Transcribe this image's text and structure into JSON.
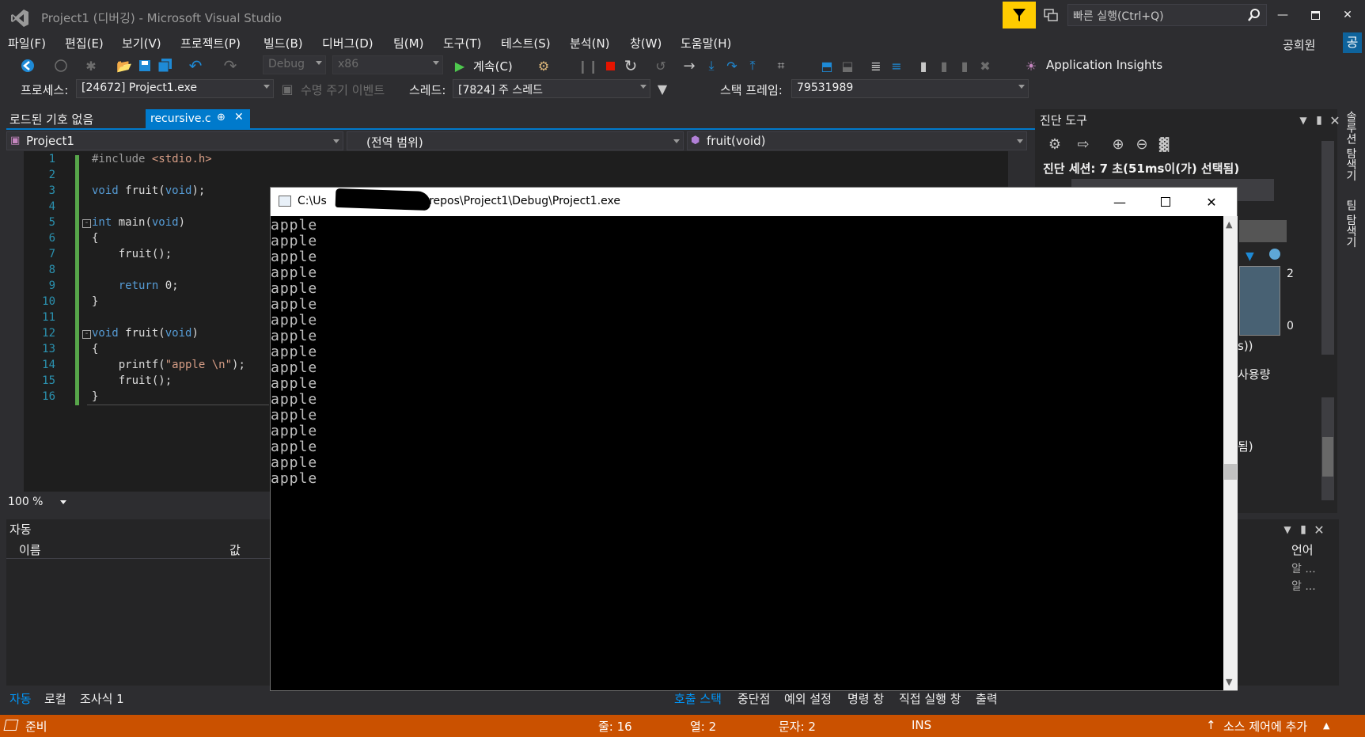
{
  "window": {
    "title": "Project1 (디버깅) - Microsoft Visual Studio",
    "quick_launch_placeholder": "빠른 실행(Ctrl+Q)",
    "user": "공희원",
    "user_badge": "공"
  },
  "menu": [
    "파일(F)",
    "편집(E)",
    "보기(V)",
    "프로젝트(P)",
    "빌드(B)",
    "디버그(D)",
    "팀(M)",
    "도구(T)",
    "테스트(S)",
    "분석(N)",
    "창(W)",
    "도움말(H)"
  ],
  "toolbar": {
    "config": "Debug",
    "platform": "x86",
    "continue_label": "계속(C)",
    "app_insights": "Application Insights"
  },
  "debug_location": {
    "process_label": "프로세스:",
    "process_value": "[24672] Project1.exe",
    "lifecycle_label": "수명 주기 이벤트",
    "thread_label": "스레드:",
    "thread_value": "[7824] 주 스레드",
    "stackframe_label": "스택 프레임:",
    "stackframe_value": "79531989"
  },
  "editor": {
    "no_symbols_tab": "로드된 기호 없음",
    "active_tab": "recursive.c",
    "nav_project": "Project1",
    "nav_scope": "(전역 범위)",
    "nav_function": "fruit(void)",
    "zoom": "100 %",
    "line_numbers": [
      "1",
      "2",
      "3",
      "4",
      "5",
      "6",
      "7",
      "8",
      "9",
      "10",
      "11",
      "12",
      "13",
      "14",
      "15",
      "16"
    ],
    "lines": [
      "#include <stdio.h>",
      "",
      "void fruit(void);",
      "",
      "int main(void)",
      "{",
      "    fruit();",
      "",
      "    return 0;",
      "}",
      "",
      "void fruit(void)",
      "{",
      "    printf(\"apple \\n\");",
      "    fruit();",
      "}"
    ]
  },
  "console": {
    "title": "C:\\Users\\         \\source\\repos\\Project1\\Debug\\Project1.exe",
    "title_shown": "C:\\Us",
    "title_rest": "e\\repos\\Project1\\Debug\\Project1.exe",
    "output": [
      "apple",
      "apple",
      "apple",
      "apple",
      "apple",
      "apple",
      "apple",
      "apple",
      "apple",
      "apple",
      "apple",
      "apple",
      "apple",
      "apple",
      "apple",
      "apple",
      "apple"
    ]
  },
  "diagnostics": {
    "title": "진단 도구",
    "session": "진단 세션: 7 초(51ms이(가) 선택됨)",
    "axis_top": "2",
    "axis_bottom": "0",
    "partial_1": "s))",
    "partial_2": "사용량",
    "partial_3": "됨)"
  },
  "side_strip": [
    "솔루션 탐색기",
    "팀 탐색기"
  ],
  "autos": {
    "title": "자동",
    "col_name": "이름",
    "col_value": "값",
    "col_lang": "언어",
    "lang_rows": [
      "알 ...",
      "알 ..."
    ]
  },
  "bottom_tabs_left": [
    "자동",
    "로컬",
    "조사식 1"
  ],
  "bottom_tabs_right": [
    "호출 스택",
    "중단점",
    "예외 설정",
    "명령 창",
    "직접 실행 창",
    "출력"
  ],
  "status": {
    "ready": "준비",
    "line": "줄: 16",
    "col": "열: 2",
    "char": "문자: 2",
    "mode": "INS",
    "source_control": "소스 제어에 추가"
  },
  "colors": {
    "accent": "#007acc",
    "statusbar": "#ca5100",
    "filter": "#ffcc00"
  }
}
